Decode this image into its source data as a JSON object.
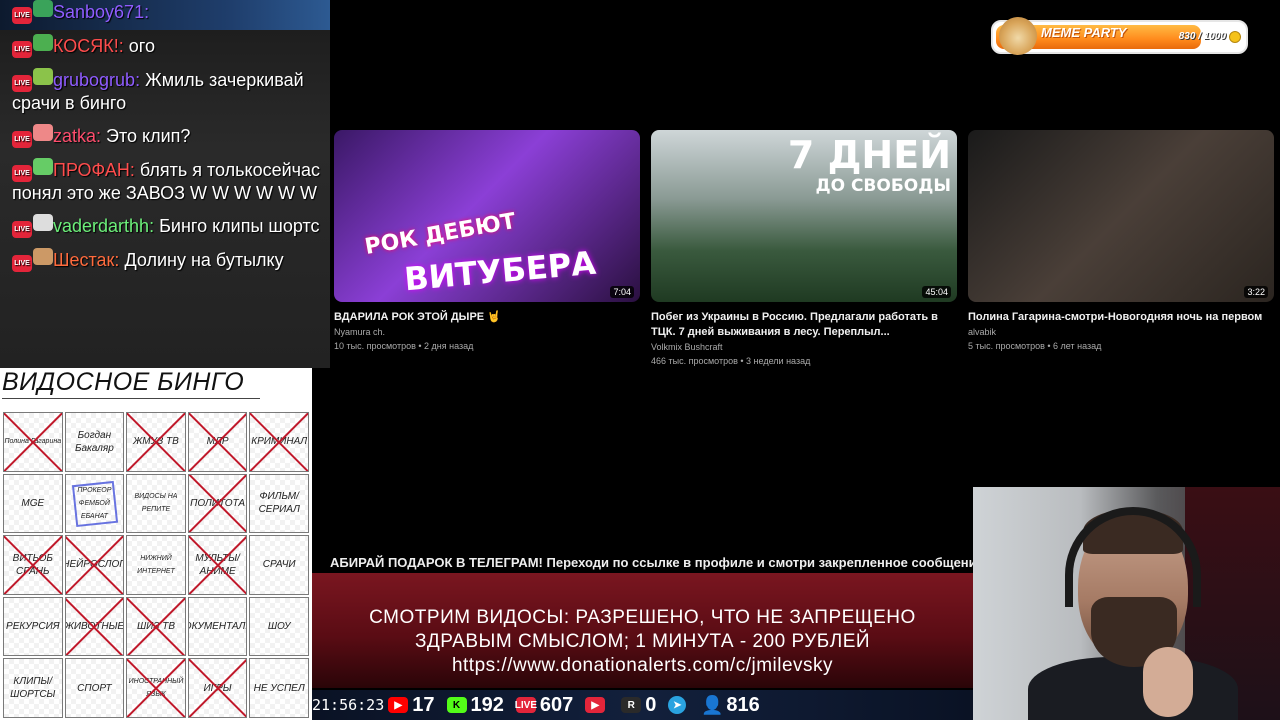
{
  "chat": {
    "messages": [
      {
        "nick": "Sanboy671:",
        "nick_color": "#8f5cff",
        "text": ""
      },
      {
        "nick": "КОСЯК!:",
        "nick_color": "#ff4d4d",
        "text": "ого"
      },
      {
        "nick": "grubogrub:",
        "nick_color": "#8f5cff",
        "text": "Жмиль зачеркивай срачи в бинго"
      },
      {
        "nick": "zatka:",
        "nick_color": "#ff4d6d",
        "text": "Это клип?"
      },
      {
        "nick": "ПРОФАН:",
        "nick_color": "#ff4d4d",
        "text": "блять я толькосейчас понял это же ЗАВОЗ W W W W W W"
      },
      {
        "nick": "vaderdarthh:",
        "nick_color": "#6cf07a",
        "text": "Бинго клипы шортс"
      },
      {
        "nick": "Шестак:",
        "nick_color": "#ff6b3d",
        "text": "Долину на бутылку"
      }
    ],
    "live_badge": "LIVE"
  },
  "bingo": {
    "title": "ВИДОСНОЕ БИНГО",
    "cells": [
      {
        "label": "Полина Гагарина",
        "crossed": true
      },
      {
        "label": "Богдан Бакаляр",
        "crossed": false
      },
      {
        "label": "ЖМУЗ ТВ",
        "crossed": true
      },
      {
        "label": "МЛР",
        "crossed": true
      },
      {
        "label": "КРИМИНАЛ",
        "crossed": true
      },
      {
        "label": "MGE",
        "crossed": false
      },
      {
        "label": "ПРОКЕОР ФЕМБОЙ ЕБАНАТ",
        "crossed": false,
        "scribbled": true
      },
      {
        "label": "ВИДОСЫ НА РЕПИТЕ",
        "crossed": false
      },
      {
        "label": "ПОЛИТОТА",
        "crossed": true
      },
      {
        "label": "ФИЛЬМ/ СЕРИАЛ",
        "crossed": false
      },
      {
        "label": "ВИТЬОБ СРАНЬ",
        "crossed": true
      },
      {
        "label": "НЕЙРОСЛОП",
        "crossed": true
      },
      {
        "label": "НИЖНИЙ ИНТЕРНЕТ",
        "crossed": false
      },
      {
        "label": "МУЛЬТЫ/ АНИМЕ",
        "crossed": true
      },
      {
        "label": "СРАЧИ",
        "crossed": false
      },
      {
        "label": "РЕКУРСИЯ",
        "crossed": false
      },
      {
        "label": "ЖИВОТНЫЕ",
        "crossed": true
      },
      {
        "label": "ШИЗ ТВ",
        "crossed": true
      },
      {
        "label": "ДОКУМЕНТАЛКИ",
        "crossed": false
      },
      {
        "label": "ШОУ",
        "crossed": false
      },
      {
        "label": "КЛИПЫ/ ШОРТСЫ",
        "crossed": false
      },
      {
        "label": "СПОРТ",
        "crossed": false
      },
      {
        "label": "ИНОСТРАННЫЙ ЯЗЫК",
        "crossed": true
      },
      {
        "label": "ИГРЫ",
        "crossed": true
      },
      {
        "label": "НЕ УСПЕЛ",
        "crossed": false
      }
    ]
  },
  "videos": [
    {
      "title": "ВДАРИЛА РОК ЭТОЙ ДЫРЕ 🤘",
      "channel": "Nyamura ch.",
      "meta": "10 тыс. просмотров • 2 дня назад",
      "duration": "7:04",
      "overlay_line1": "РОК ДЕБЮТ",
      "overlay_line2": "ВИТУБЕРА"
    },
    {
      "title": "Побег из Украины в Россию. Предлагали работать в ТЦК. 7 дней выживания в лесу. Переплыл...",
      "channel": "Volkmix Bushcraft",
      "meta": "466 тыс. просмотров • 3 недели назад",
      "duration": "45:04",
      "overlay_line1": "7 ДНЕЙ",
      "overlay_line2": "ДО СВОБОДЫ"
    },
    {
      "title": "Полина Гагарина-смотри-Новогодняя ночь на первом",
      "channel": "alvabik",
      "meta": "5 тыс. просмотров • 6 лет назад",
      "duration": "3:22"
    }
  ],
  "ticker": "АБИРАЙ ПОДАРОК В ТЕЛЕГРАМ! Переходи по ссылке в профиле и смотри закрепленное сообщени",
  "rules": {
    "line1": "СМОТРИМ ВИДОСЫ: РАЗРЕШЕНО, ЧТО НЕ ЗАПРЕЩЕНО",
    "line2": "ЗДРАВЫМ СМЫСЛОМ; 1 МИНУТА - 200 РУБЛЕЙ",
    "line3": "https://www.donationalerts.com/c/jmilevsky"
  },
  "status": {
    "clock": "21:56:23",
    "youtube": "17",
    "kick": "192",
    "vk_live": "607",
    "trovo": "",
    "rutube": "0",
    "viewers": "816",
    "colors": {
      "youtube": "#ff0000",
      "kick": "#53fc18",
      "vk_live": "#e3253a",
      "trovo": "#e3253a",
      "rutube": "#2a2a2a",
      "telegram": "#2aa3e0",
      "viewers": "#3aa0ff"
    }
  },
  "meme_party": {
    "title": "MEME PARTY",
    "count": "830 / 1000",
    "progress": 0.83
  }
}
